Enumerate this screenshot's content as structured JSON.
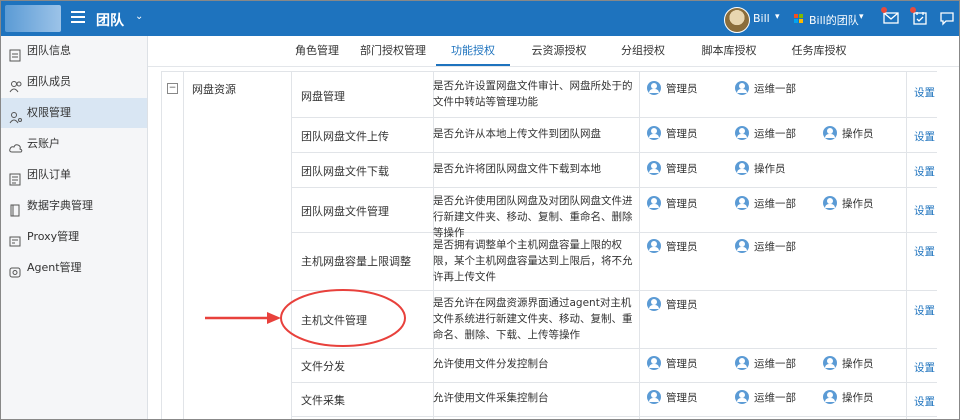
{
  "header": {
    "team_title": "团队",
    "user_name": "Bill",
    "org_name": "Bill的团队"
  },
  "sidebar": {
    "items": [
      {
        "label": "团队信息",
        "icon": "id-card-icon"
      },
      {
        "label": "团队成员",
        "icon": "users-icon"
      },
      {
        "label": "权限管理",
        "icon": "user-key-icon",
        "active": true
      },
      {
        "label": "云账户",
        "icon": "cloud-icon"
      },
      {
        "label": "团队订单",
        "icon": "order-icon"
      },
      {
        "label": "数据字典管理",
        "icon": "book-icon"
      },
      {
        "label": "Proxy管理",
        "icon": "proxy-icon"
      },
      {
        "label": "Agent管理",
        "icon": "agent-icon"
      }
    ]
  },
  "tabs": [
    {
      "label": "角色管理"
    },
    {
      "label": "部门授权管理"
    },
    {
      "label": "功能授权",
      "active": true
    },
    {
      "label": "云资源授权"
    },
    {
      "label": "分组授权"
    },
    {
      "label": "脚本库授权"
    },
    {
      "label": "任务库授权"
    }
  ],
  "group": {
    "toggle": "−",
    "label": "网盘资源"
  },
  "rows": [
    {
      "name": "网盘管理",
      "desc": "是否允许设置网盘文件审计、网盘所处于的文件中转站等管理功能",
      "roles": [
        "管理员",
        "运维一部"
      ],
      "action": "设置"
    },
    {
      "name": "团队网盘文件上传",
      "desc": "是否允许从本地上传文件到团队网盘",
      "roles": [
        "管理员",
        "运维一部",
        "操作员"
      ],
      "action": "设置"
    },
    {
      "name": "团队网盘文件下载",
      "desc": "是否允许将团队网盘文件下载到本地",
      "roles": [
        "管理员",
        "操作员"
      ],
      "action": "设置"
    },
    {
      "name": "团队网盘文件管理",
      "desc": "是否允许使用团队网盘及对团队网盘文件进行新建文件夹、移动、复制、重命名、删除等操作",
      "roles": [
        "管理员",
        "运维一部",
        "操作员"
      ],
      "action": "设置"
    },
    {
      "name": "主机网盘容量上限调整",
      "desc": "是否拥有调整单个主机网盘容量上限的权限，某个主机网盘容量达到上限后，将不允许再上传文件",
      "roles": [
        "管理员",
        "运维一部"
      ],
      "action": "设置"
    },
    {
      "name": "主机文件管理",
      "desc": "是否允许在网盘资源界面通过agent对主机文件系统进行新建文件夹、移动、复制、重命名、删除、下载、上传等操作",
      "roles": [
        "管理员"
      ],
      "action": "设置"
    },
    {
      "name": "文件分发",
      "desc": "允许使用文件分发控制台",
      "roles": [
        "管理员",
        "运维一部",
        "操作员"
      ],
      "action": "设置"
    },
    {
      "name": "文件采集",
      "desc": "允许使用文件采集控制台",
      "roles": [
        "管理员",
        "运维一部",
        "操作员"
      ],
      "action": "设置"
    }
  ],
  "colors": {
    "brand": "#1e73be",
    "annotation": "#e8413c"
  }
}
